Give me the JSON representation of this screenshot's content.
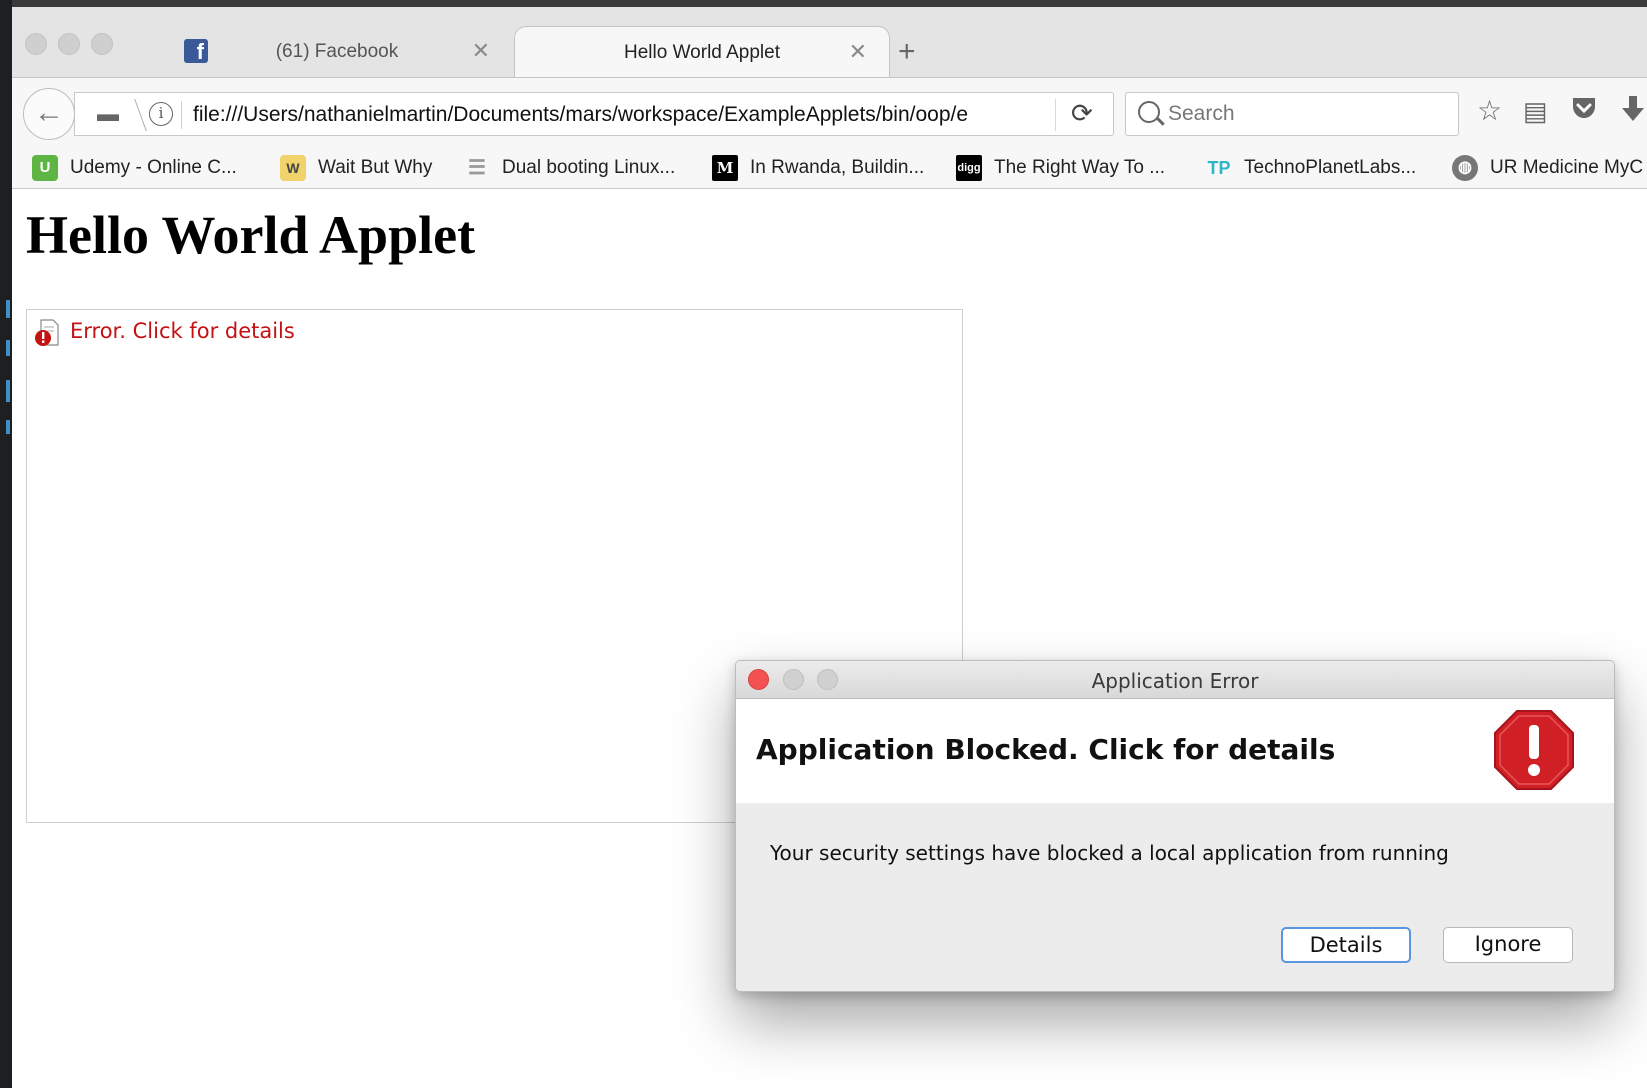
{
  "browser": {
    "tabs": [
      {
        "label": "(61) Facebook",
        "active": false,
        "favicon": "facebook-icon"
      },
      {
        "label": "Hello World Applet",
        "active": true
      }
    ],
    "url": "file:///Users/nathanielmartin/Documents/mars/workspace/ExampleApplets/bin/oop/e",
    "search_placeholder": "Search",
    "bookmarks": [
      {
        "label": "Udemy - Online C...",
        "icon": "udemy-icon"
      },
      {
        "label": "Wait But Why",
        "icon": "waitbutwhy-icon"
      },
      {
        "label": "Dual booting Linux...",
        "icon": "page-icon"
      },
      {
        "label": "In Rwanda, Buildin...",
        "icon": "medium-icon"
      },
      {
        "label": "The Right Way To ...",
        "icon": "digg-icon"
      },
      {
        "label": "TechnoPlanetLabs...",
        "icon": "tp-icon"
      },
      {
        "label": "UR Medicine MyC",
        "icon": "globe-icon"
      }
    ]
  },
  "page": {
    "heading": "Hello World Applet",
    "applet_error": "Error. Click for details"
  },
  "dialog": {
    "title": "Application Error",
    "headline": "Application Blocked. Click for details",
    "message": "Your security settings have blocked a local application from running",
    "details_label": "Details",
    "ignore_label": "Ignore"
  },
  "colors": {
    "error_red": "#c41212",
    "facebook_blue": "#3b5998",
    "close_red": "#f25252",
    "focus_blue": "#5a95e0"
  }
}
